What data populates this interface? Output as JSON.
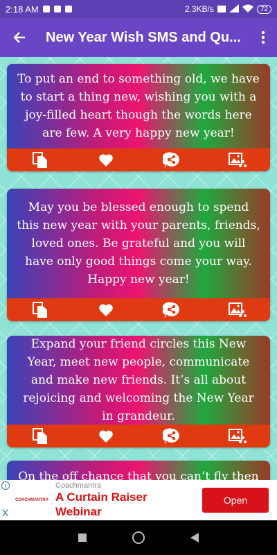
{
  "status_bar": {
    "time": "2:18 AM",
    "speed": "2.3KB/s",
    "battery": "72"
  },
  "app_bar": {
    "title": "New Year Wish SMS and Qu..."
  },
  "quotes": [
    "To put an end to something old, we have to start a thing new, wishing you with a joy-filled heart though the words here are few. A very happy new year!",
    "May you be blessed enough to spend this new year with your parents, friends, loved ones. Be grateful and you will have only good things come your way. Happy new year!",
    "Expand your friend circles this New Year, meet new people, communicate and make new friends. It’s all about rejoicing and welcoming the New Year in grandeur.",
    "On the off chance that you can’t fly then"
  ],
  "ad": {
    "brand": "Coachmantra",
    "logo_text": "COACHMANTRA",
    "headline_1": "A Curtain Raiser",
    "headline_2": "Webinar",
    "button": "Open",
    "info": "i",
    "close": "X"
  },
  "colors": {
    "status_bar": "#5b3fb3",
    "app_bar": "#6a45c6",
    "action_bar": "#e03a12",
    "ad_button": "#d8111a"
  },
  "icons": [
    "back-arrow-icon",
    "more-vert-icon",
    "copy-icon",
    "heart-icon",
    "share-icon",
    "image-share-icon"
  ]
}
